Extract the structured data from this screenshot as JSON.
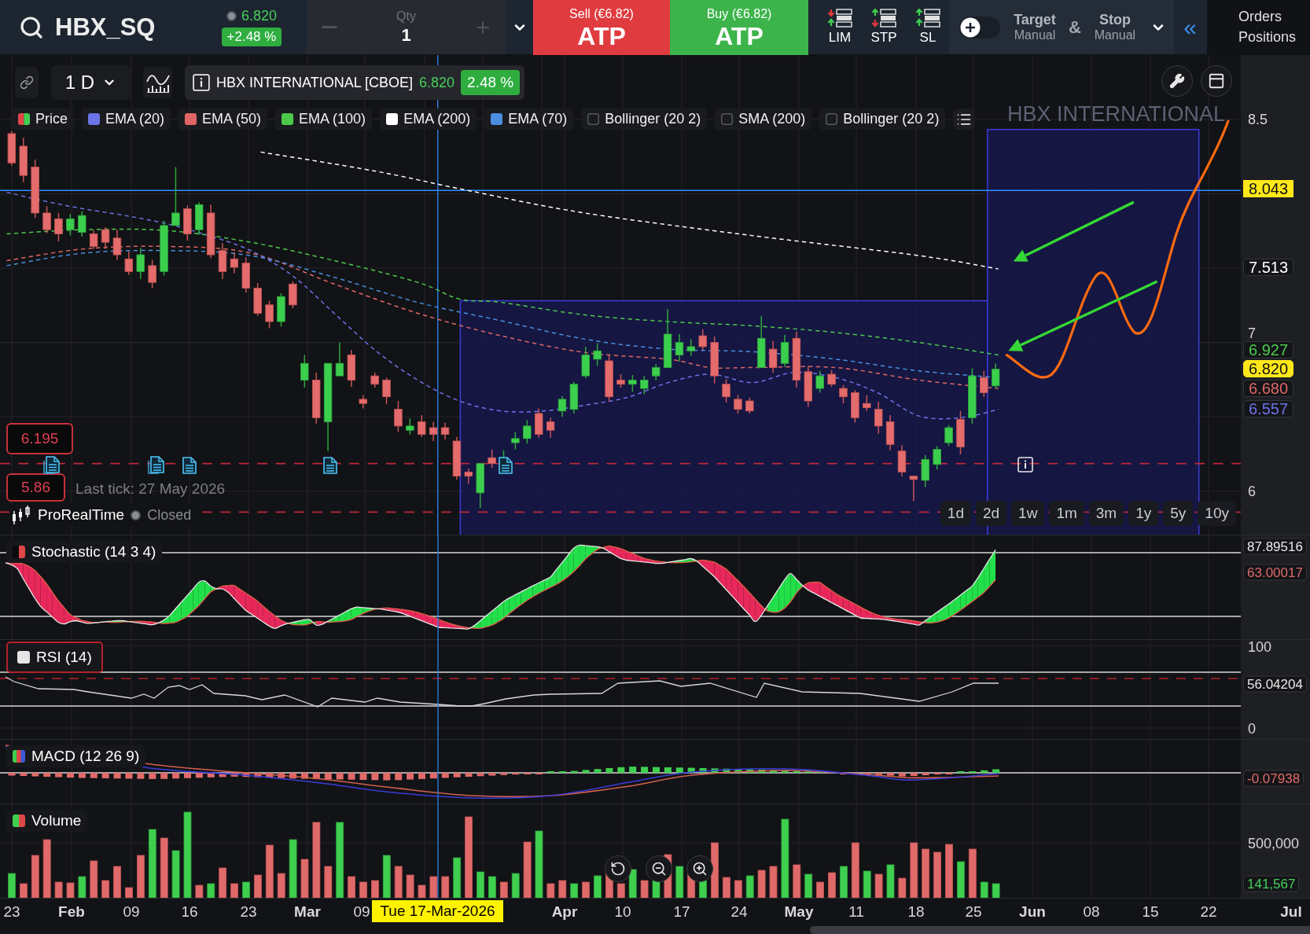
{
  "toolbar": {
    "symbol": "HBX_SQ",
    "price": "6.820",
    "change": "+2.48 %",
    "quantity": {
      "label": "Qty",
      "value": "1"
    },
    "sell": {
      "label": "Sell (€6.82)",
      "value": "ATP"
    },
    "buy": {
      "label": "Buy (€6.82)",
      "value": "ATP"
    },
    "order_types": [
      {
        "label": "LIM",
        "kind": "limit"
      },
      {
        "label": "STP",
        "kind": "stop"
      },
      {
        "label": "SL",
        "kind": "stop_loss"
      }
    ],
    "quick_toggle": {
      "on": false
    },
    "target": {
      "label": "Target",
      "value": "Manual"
    },
    "joiner": "&",
    "stop": {
      "label": "Stop",
      "value": "Manual"
    },
    "collapse": "«",
    "panels": [
      "Orders",
      "Positions"
    ]
  },
  "chart": {
    "interval": "1 D",
    "instrument": {
      "name": "HBX INTERNATIONAL [CBOE]",
      "price": "6.820",
      "change": "2.48 %"
    },
    "legend": [
      {
        "label": "Price",
        "kind": "split"
      },
      {
        "label": "EMA (20)",
        "kind": "swatch",
        "color": "#6b74e8"
      },
      {
        "label": "EMA (50)",
        "kind": "swatch",
        "color": "#e06666"
      },
      {
        "label": "EMA (100)",
        "kind": "swatch",
        "color": "#4cc94c"
      },
      {
        "label": "EMA (200)",
        "kind": "swatch",
        "color": "#ffffff"
      },
      {
        "label": "EMA (70)",
        "kind": "swatch",
        "color": "#4a8ee0"
      },
      {
        "label": "Bollinger (20 2)",
        "kind": "empty"
      },
      {
        "label": "SMA (200)",
        "kind": "empty"
      },
      {
        "label": "Bollinger (20 2)",
        "kind": "empty"
      }
    ],
    "instrument_label": "HBX INTERNATIONAL",
    "price_axis": [
      {
        "text": "8.5",
        "kind": "tick"
      },
      {
        "text": "8.043",
        "kind": "line"
      },
      {
        "text": "7.513",
        "kind": "level",
        "color": "#ffffff"
      },
      {
        "text": "7",
        "kind": "tick"
      },
      {
        "text": "6.927",
        "kind": "level",
        "color": "#4cc94c"
      },
      {
        "text": "6.820",
        "kind": "price"
      },
      {
        "text": "6.680",
        "kind": "level",
        "color": "#e06666"
      },
      {
        "text": "6.557",
        "kind": "level",
        "color": "#6b74e8"
      },
      {
        "text": "6",
        "kind": "tick"
      }
    ],
    "level_tags": [
      "6.195",
      "5.86"
    ],
    "last_tick": "Last tick: 27 May 2026",
    "source": "ProRealTime",
    "market": {
      "label": "Closed",
      "open": false
    },
    "ranges": [
      {
        "label": "1d",
        "selected": false
      },
      {
        "label": "2d",
        "selected": false
      },
      {
        "label": "1w",
        "selected": false
      },
      {
        "label": "1m",
        "selected": false
      },
      {
        "label": "3m",
        "selected": false
      },
      {
        "label": "1y",
        "selected": false
      },
      {
        "label": "5y",
        "selected": false
      },
      {
        "label": "10y",
        "selected": false
      }
    ],
    "crosshair_date": "Tue 17-Mar-2026",
    "date_axis": [
      {
        "text": "23",
        "kind": "day"
      },
      {
        "text": "Feb",
        "kind": "month"
      },
      {
        "text": "09",
        "kind": "day"
      },
      {
        "text": "16",
        "kind": "day"
      },
      {
        "text": "23",
        "kind": "day"
      },
      {
        "text": "Mar",
        "kind": "month"
      },
      {
        "text": "09",
        "kind": "day"
      },
      {
        "text": "Apr",
        "kind": "month"
      },
      {
        "text": "10",
        "kind": "day"
      },
      {
        "text": "17",
        "kind": "day"
      },
      {
        "text": "24",
        "kind": "day"
      },
      {
        "text": "May",
        "kind": "month"
      },
      {
        "text": "11",
        "kind": "day"
      },
      {
        "text": "18",
        "kind": "day"
      },
      {
        "text": "25",
        "kind": "day"
      },
      {
        "text": "Jun",
        "kind": "month"
      },
      {
        "text": "08",
        "kind": "day"
      },
      {
        "text": "15",
        "kind": "day"
      },
      {
        "text": "22",
        "kind": "day"
      },
      {
        "text": "Jul",
        "kind": "month"
      }
    ]
  },
  "panes": [
    {
      "kind": "stochastic",
      "title": "Stochastic (14 3 4)",
      "selected": false,
      "axis": [
        {
          "text": "87.89516",
          "kind": "level",
          "color": "#e8e8e8"
        },
        {
          "text": "63.00017",
          "kind": "level",
          "color": "#e06a6a"
        }
      ]
    },
    {
      "kind": "rsi",
      "title": "RSI (14)",
      "selected": true,
      "axis": [
        {
          "text": "100",
          "kind": "tick"
        },
        {
          "text": "56.04204",
          "kind": "level",
          "color": "#e8e8e8"
        },
        {
          "text": "0",
          "kind": "tick"
        }
      ]
    },
    {
      "kind": "macd",
      "title": "MACD (12 26 9)",
      "selected": false,
      "axis": [
        {
          "text": "-0.07938",
          "kind": "level",
          "color": "#e06a6a"
        }
      ]
    },
    {
      "kind": "volume",
      "title": "Volume",
      "selected": false,
      "axis": [
        {
          "text": "500,000",
          "kind": "tick"
        },
        {
          "text": "141,567",
          "kind": "level",
          "color": "#46d15a"
        }
      ]
    }
  ]
}
